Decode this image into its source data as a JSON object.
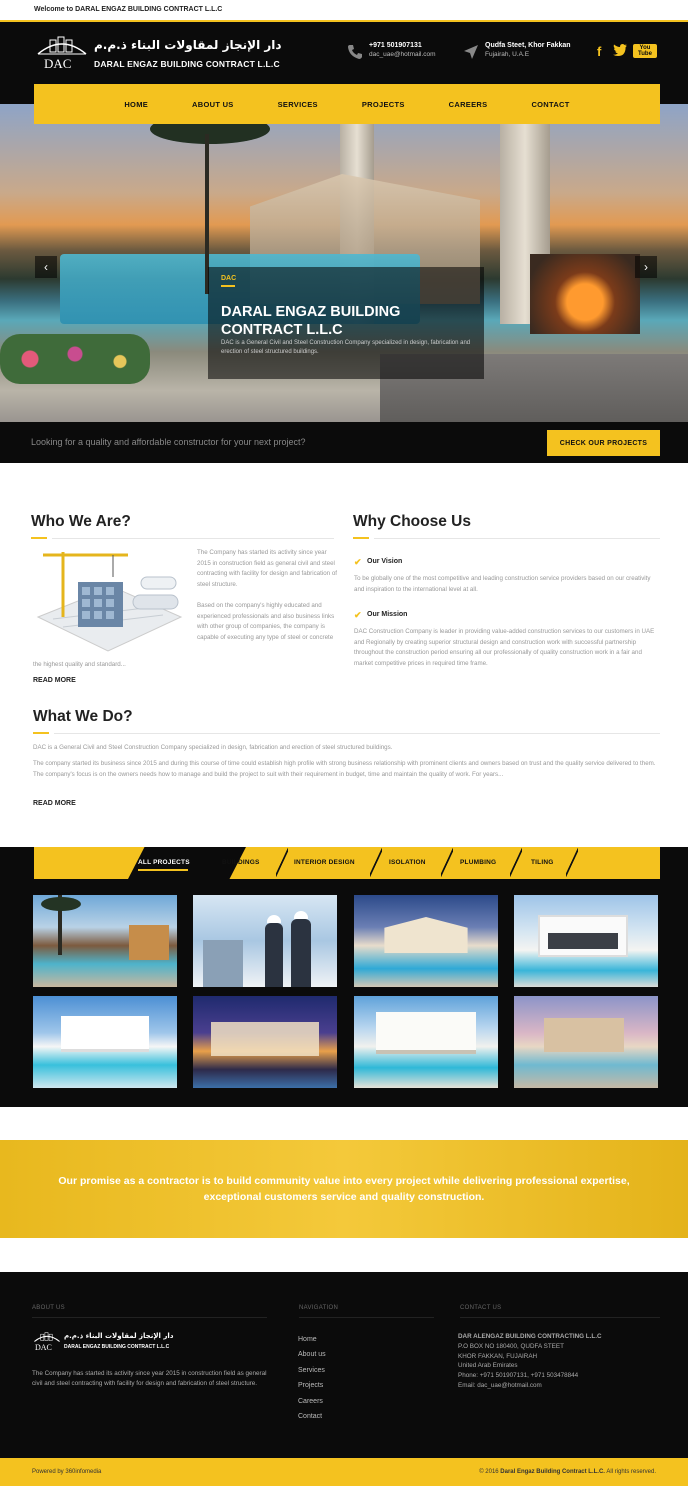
{
  "topbar": {
    "welcome": "Welcome to DARAL ENGAZ BUILDING CONTRACT L.L.C"
  },
  "header": {
    "logo_arabic": "دار الإنجاز لمقاولات البناء ذ.م.م",
    "logo_english": "DARAL ENGAZ BUILDING CONTRACT L.L.C",
    "logo_abbr": "DAC",
    "phone": "+971 501907131",
    "email": "dac_uae@hotmail.com",
    "address_line1": "Qudfa Steet, Khor Fakkan",
    "address_line2": "Fujairah, U.A.E",
    "social": [
      "f",
      "t",
      "You Tube"
    ]
  },
  "nav": [
    "HOME",
    "ABOUT US",
    "SERVICES",
    "PROJECTS",
    "CAREERS",
    "CONTACT"
  ],
  "hero": {
    "tag": "DAC",
    "title": "DARAL ENGAZ BUILDING CONTRACT L.L.C",
    "text": "DAC is a General Civil and Steel Construction Company specialized in design, fabrication and erection of steel structured buildings."
  },
  "cta": {
    "text": "Looking for a quality and affordable constructor for your next project?",
    "button": "CHECK OUR PROJECTS"
  },
  "who": {
    "title": "Who We Are?",
    "p1": "The Company has started its activity since year 2015 in construction field as general civil and steel contracting with facility for design and fabrication of steel structure.",
    "p2": "Based on the company's highly educated and experienced professionals and also business links with other group of companies, the company is capable of executing any type of steel or concrete",
    "p3": "the highest quality and standard...",
    "read_more": "READ MORE"
  },
  "why": {
    "title": "Why Choose Us",
    "vision_title": "Our Vision",
    "vision_text": "To be globally one of the most competitive and leading construction service providers based on our creativity and inspiration to the international level at all.",
    "mission_title": "Our Mission",
    "mission_text": "DAC Construction Company is leader in providing value-added construction services to our customers in UAE and Regionally by creating superior structural design and construction work with successful partnership throughout the construction period ensuring all our professionally of quality construction work in a fair and market competitive prices in required time frame."
  },
  "what": {
    "title": "What We Do?",
    "p1": "DAC is a General Civil and Steel Construction Company specialized in design, fabrication and erection of steel structured buildings.",
    "p2": "The company started its business since 2015 and during this course of time could establish high profile with strong business relationship with prominent clients and owners based on trust and the quality service delivered to them. The company's focus is on the owners needs how to manage and build the project to suit with their requirement in budget, time and maintain the quality of work. For years...",
    "read_more": "READ MORE"
  },
  "project_tabs": [
    "ALL PROJECTS",
    "BUILDINGS",
    "INTERIOR DESIGN",
    "ISOLATION",
    "PLUMBING",
    "TILING"
  ],
  "promise": "Our promise as a contractor is to build community value into every project while delivering professional expertise, exceptional customers service and quality construction.",
  "footer": {
    "about_heading": "ABOUT US",
    "about_text": "The Company has started its activity since year 2015 in construction field as general civil and steel contracting with facility for design and fabrication of steel structure.",
    "nav_heading": "NAVIGATION",
    "nav_links": [
      "Home",
      "About us",
      "Services",
      "Projects",
      "Careers",
      "Contact"
    ],
    "contact_heading": "CONTACT US",
    "company": "DAR ALENGAZ BUILDING CONTRACTING L.L.C",
    "box": "P.O BOX NO 180400, QUDFA STEET",
    "city": "KHOR FAKKAN, FUJAIRAH",
    "country": "United Arab Emirates",
    "phone": "Phone: +971 501907131, +971 503478844",
    "email": "Email: dac_uae@hotmail.com"
  },
  "bottom": {
    "powered": "Powered by 360infomedia",
    "copy_prefix": "© 2016",
    "copy_company": "Daral Engaz Building Contract L.L.C.",
    "copy_suffix": "All rights reserved."
  },
  "colors": {
    "accent": "#f4c21f",
    "dark": "#0b0b0b"
  }
}
